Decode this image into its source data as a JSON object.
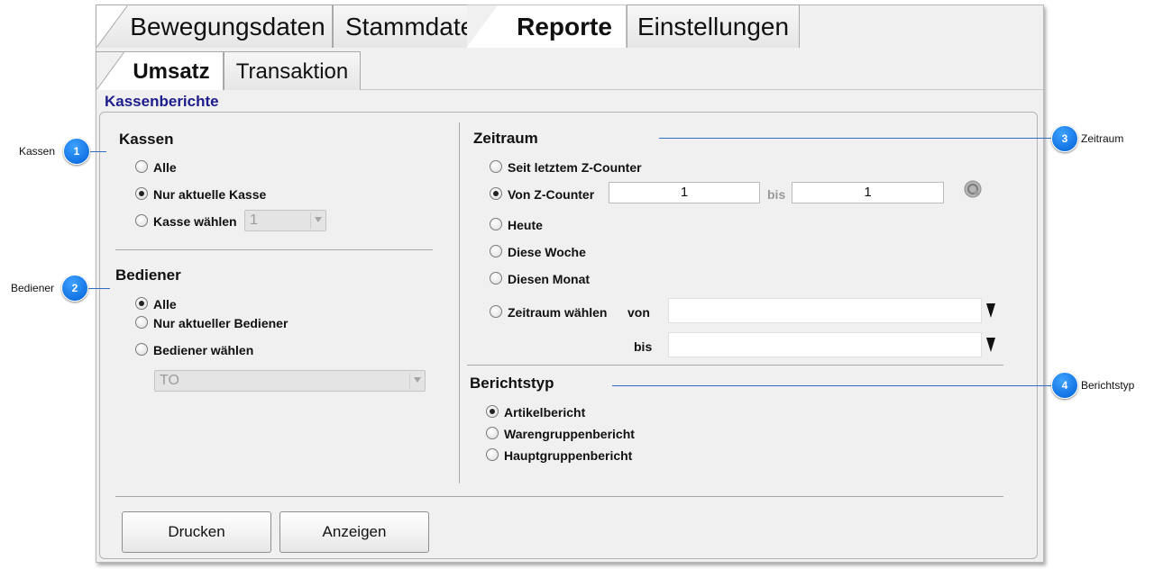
{
  "tabs": [
    "Bewegungsdaten",
    "Stammdaten",
    "Reporte",
    "Einstellungen"
  ],
  "subtabs": [
    "Umsatz",
    "Transaktion"
  ],
  "section_title": "Kassenberichte",
  "kassen": {
    "heading": "Kassen",
    "options": [
      "Alle",
      "Nur aktuelle Kasse",
      "Kasse wählen"
    ],
    "selected": "Nur aktuelle Kasse",
    "combo_value": "1"
  },
  "bediener": {
    "heading": "Bediener",
    "options": [
      "Alle",
      "Nur aktueller Bediener",
      "Bediener wählen"
    ],
    "selected": "Alle",
    "combo_value": "TO"
  },
  "zeitraum": {
    "heading": "Zeitraum",
    "options": [
      "Seit letztem Z-Counter",
      "Von Z-Counter",
      "Heute",
      "Diese Woche",
      "Diesen Monat",
      "Zeitraum wählen"
    ],
    "selected": "Von Z-Counter",
    "z_from": "1",
    "z_bis_label": "bis",
    "z_to": "1",
    "von_label": "von",
    "bis_label": "bis"
  },
  "berichtstyp": {
    "heading": "Berichtstyp",
    "options": [
      "Artikelbericht",
      "Warengruppenbericht",
      "Hauptgruppenbericht"
    ],
    "selected": "Artikelbericht"
  },
  "buttons": {
    "print": "Drucken",
    "show": "Anzeigen"
  },
  "callouts": [
    {
      "number": "1",
      "label": "Kassen"
    },
    {
      "number": "2",
      "label": "Bediener"
    },
    {
      "number": "3",
      "label": "Zeitraum"
    },
    {
      "number": "4",
      "label": "Berichtstyp"
    }
  ],
  "colors": {
    "section_title": "#1c1c8c",
    "callout": "#1e83f0"
  }
}
